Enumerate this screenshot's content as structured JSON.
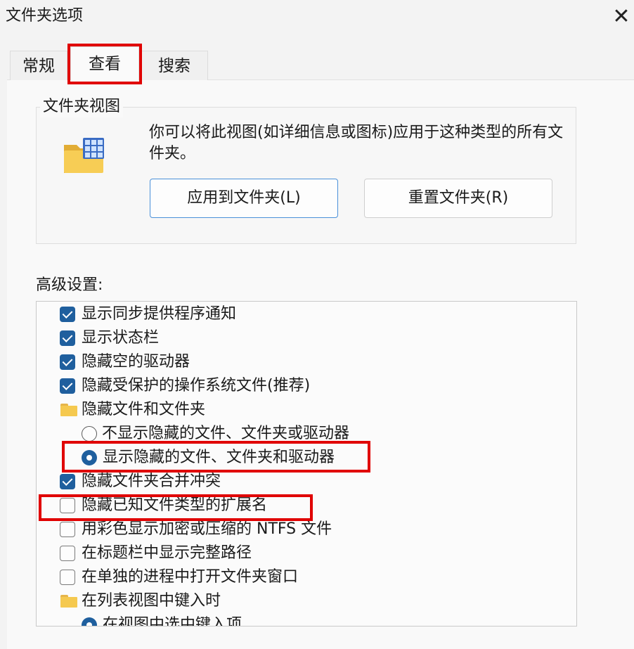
{
  "window": {
    "title": "文件夹选项",
    "close_icon": "close-icon"
  },
  "tabs": [
    {
      "label": "常规",
      "active": false
    },
    {
      "label": "查看",
      "active": true
    },
    {
      "label": "搜索",
      "active": false
    }
  ],
  "folder_views": {
    "title": "文件夹视图",
    "icon": "folder-grid-icon",
    "description": "你可以将此视图(如详细信息或图标)应用于这种类型的所有文件夹。",
    "apply_button": "应用到文件夹(L)",
    "reset_button": "重置文件夹(R)"
  },
  "advanced": {
    "label": "高级设置:",
    "items": [
      {
        "type": "checkbox",
        "checked": true,
        "label": "显示同步提供程序通知"
      },
      {
        "type": "checkbox",
        "checked": true,
        "label": "显示状态栏"
      },
      {
        "type": "checkbox",
        "checked": true,
        "label": "隐藏空的驱动器"
      },
      {
        "type": "checkbox",
        "checked": true,
        "label": "隐藏受保护的操作系统文件(推荐)"
      },
      {
        "type": "folder",
        "label": "隐藏文件和文件夹"
      },
      {
        "type": "radio",
        "checked": false,
        "label": "不显示隐藏的文件、文件夹或驱动器"
      },
      {
        "type": "radio",
        "checked": true,
        "label": "显示隐藏的文件、文件夹和驱动器"
      },
      {
        "type": "checkbox",
        "checked": true,
        "label": "隐藏文件夹合并冲突"
      },
      {
        "type": "checkbox",
        "checked": false,
        "label": "隐藏已知文件类型的扩展名"
      },
      {
        "type": "checkbox",
        "checked": false,
        "label": "用彩色显示加密或压缩的 NTFS 文件"
      },
      {
        "type": "checkbox",
        "checked": false,
        "label": "在标题栏中显示完整路径"
      },
      {
        "type": "checkbox",
        "checked": false,
        "label": "在单独的进程中打开文件夹窗口"
      },
      {
        "type": "folder",
        "label": "在列表视图中键入时"
      },
      {
        "type": "radio",
        "checked": true,
        "label": "在视图中选中键入项"
      }
    ]
  },
  "colors": {
    "highlight_box": "#e00000",
    "accent": "#1f5f9e"
  }
}
